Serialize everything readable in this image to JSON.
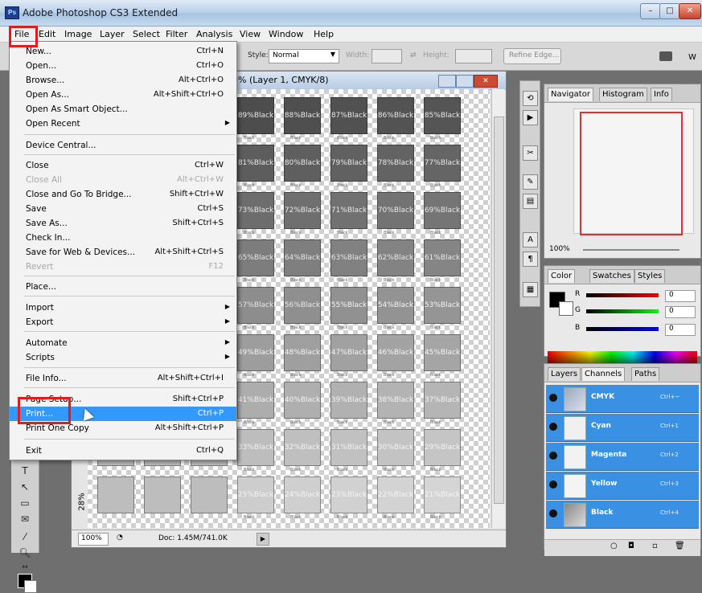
{
  "app": {
    "title": "Adobe Photoshop CS3 Extended",
    "logo": "Ps"
  },
  "menubar": [
    "File",
    "Edit",
    "Image",
    "Layer",
    "Select",
    "Filter",
    "Analysis",
    "View",
    "Window",
    "Help"
  ],
  "options": {
    "style_label": "Style:",
    "style_value": "Normal",
    "width_label": "Width:",
    "height_label": "Height:",
    "refine_edge": "Refine Edge...",
    "workspace": "W"
  },
  "document": {
    "title": "0% (Layer 1, CMYK/8)",
    "zoom": "100%",
    "doc_info": "Doc: 1.45M/741.0K",
    "side_label": "28%",
    "tile_word": "Black",
    "caption": "Black",
    "rows": [
      [
        "89%",
        "88%",
        "87%",
        "86%",
        "85%"
      ],
      [
        "81%",
        "80%",
        "79%",
        "78%",
        "77%"
      ],
      [
        "73%",
        "72%",
        "71%",
        "70%",
        "69%"
      ],
      [
        "65%",
        "64%",
        "63%",
        "62%",
        "61%"
      ],
      [
        "57%",
        "56%",
        "55%",
        "54%",
        "53%"
      ],
      [
        "49%",
        "48%",
        "47%",
        "46%",
        "45%"
      ],
      [
        "41%",
        "40%",
        "39%",
        "38%",
        "37%"
      ],
      [
        "33%",
        "32%",
        "31%",
        "30%",
        "29%"
      ],
      [
        "25%",
        "24%",
        "23%",
        "22%",
        "21%"
      ]
    ]
  },
  "file_menu": {
    "items": [
      {
        "label": "New...",
        "shortcut": "Ctrl+N"
      },
      {
        "label": "Open...",
        "shortcut": "Ctrl+O"
      },
      {
        "label": "Browse...",
        "shortcut": "Alt+Ctrl+O"
      },
      {
        "label": "Open As...",
        "shortcut": "Alt+Shift+Ctrl+O"
      },
      {
        "label": "Open As Smart Object...",
        "shortcut": ""
      },
      {
        "label": "Open Recent",
        "shortcut": "",
        "submenu": true
      },
      {
        "label": "Device Central...",
        "shortcut": ""
      },
      {
        "label": "Close",
        "shortcut": "Ctrl+W"
      },
      {
        "label": "Close All",
        "shortcut": "Alt+Ctrl+W",
        "disabled": true
      },
      {
        "label": "Close and Go To Bridge...",
        "shortcut": "Shift+Ctrl+W"
      },
      {
        "label": "Save",
        "shortcut": "Ctrl+S"
      },
      {
        "label": "Save As...",
        "shortcut": "Shift+Ctrl+S"
      },
      {
        "label": "Check In...",
        "shortcut": ""
      },
      {
        "label": "Save for Web & Devices...",
        "shortcut": "Alt+Shift+Ctrl+S"
      },
      {
        "label": "Revert",
        "shortcut": "F12",
        "disabled": true
      },
      {
        "label": "Place...",
        "shortcut": ""
      },
      {
        "label": "Import",
        "shortcut": "",
        "submenu": true
      },
      {
        "label": "Export",
        "shortcut": "",
        "submenu": true
      },
      {
        "label": "Automate",
        "shortcut": "",
        "submenu": true
      },
      {
        "label": "Scripts",
        "shortcut": "",
        "submenu": true
      },
      {
        "label": "File Info...",
        "shortcut": "Alt+Shift+Ctrl+I"
      },
      {
        "label": "Page Setup...",
        "shortcut": "Shift+Ctrl+P"
      },
      {
        "label": "Print...",
        "shortcut": "Ctrl+P",
        "highlighted": true
      },
      {
        "label": "Print One Copy",
        "shortcut": "Alt+Shift+Ctrl+P"
      },
      {
        "label": "Exit",
        "shortcut": "Ctrl+Q"
      }
    ]
  },
  "panels": {
    "navigator_tabs": [
      "Navigator",
      "Histogram",
      "Info"
    ],
    "navigator_zoom": "100%",
    "color_tabs": [
      "Color",
      "Swatches",
      "Styles"
    ],
    "color": {
      "r_label": "R",
      "g_label": "G",
      "b_label": "B",
      "r": "0",
      "g": "0",
      "b": "0"
    },
    "layers_tabs": [
      "Layers",
      "Channels",
      "Paths"
    ],
    "channels": [
      {
        "name": "CMYK",
        "shortcut": "Ctrl+~"
      },
      {
        "name": "Cyan",
        "shortcut": "Ctrl+1"
      },
      {
        "name": "Magenta",
        "shortcut": "Ctrl+2"
      },
      {
        "name": "Yellow",
        "shortcut": "Ctrl+3"
      },
      {
        "name": "Black",
        "shortcut": "Ctrl+4"
      }
    ]
  },
  "colors": {
    "highlight": "#3399ff",
    "annotation_red": "#e21c1c",
    "channel_row": "#3a91e3"
  }
}
